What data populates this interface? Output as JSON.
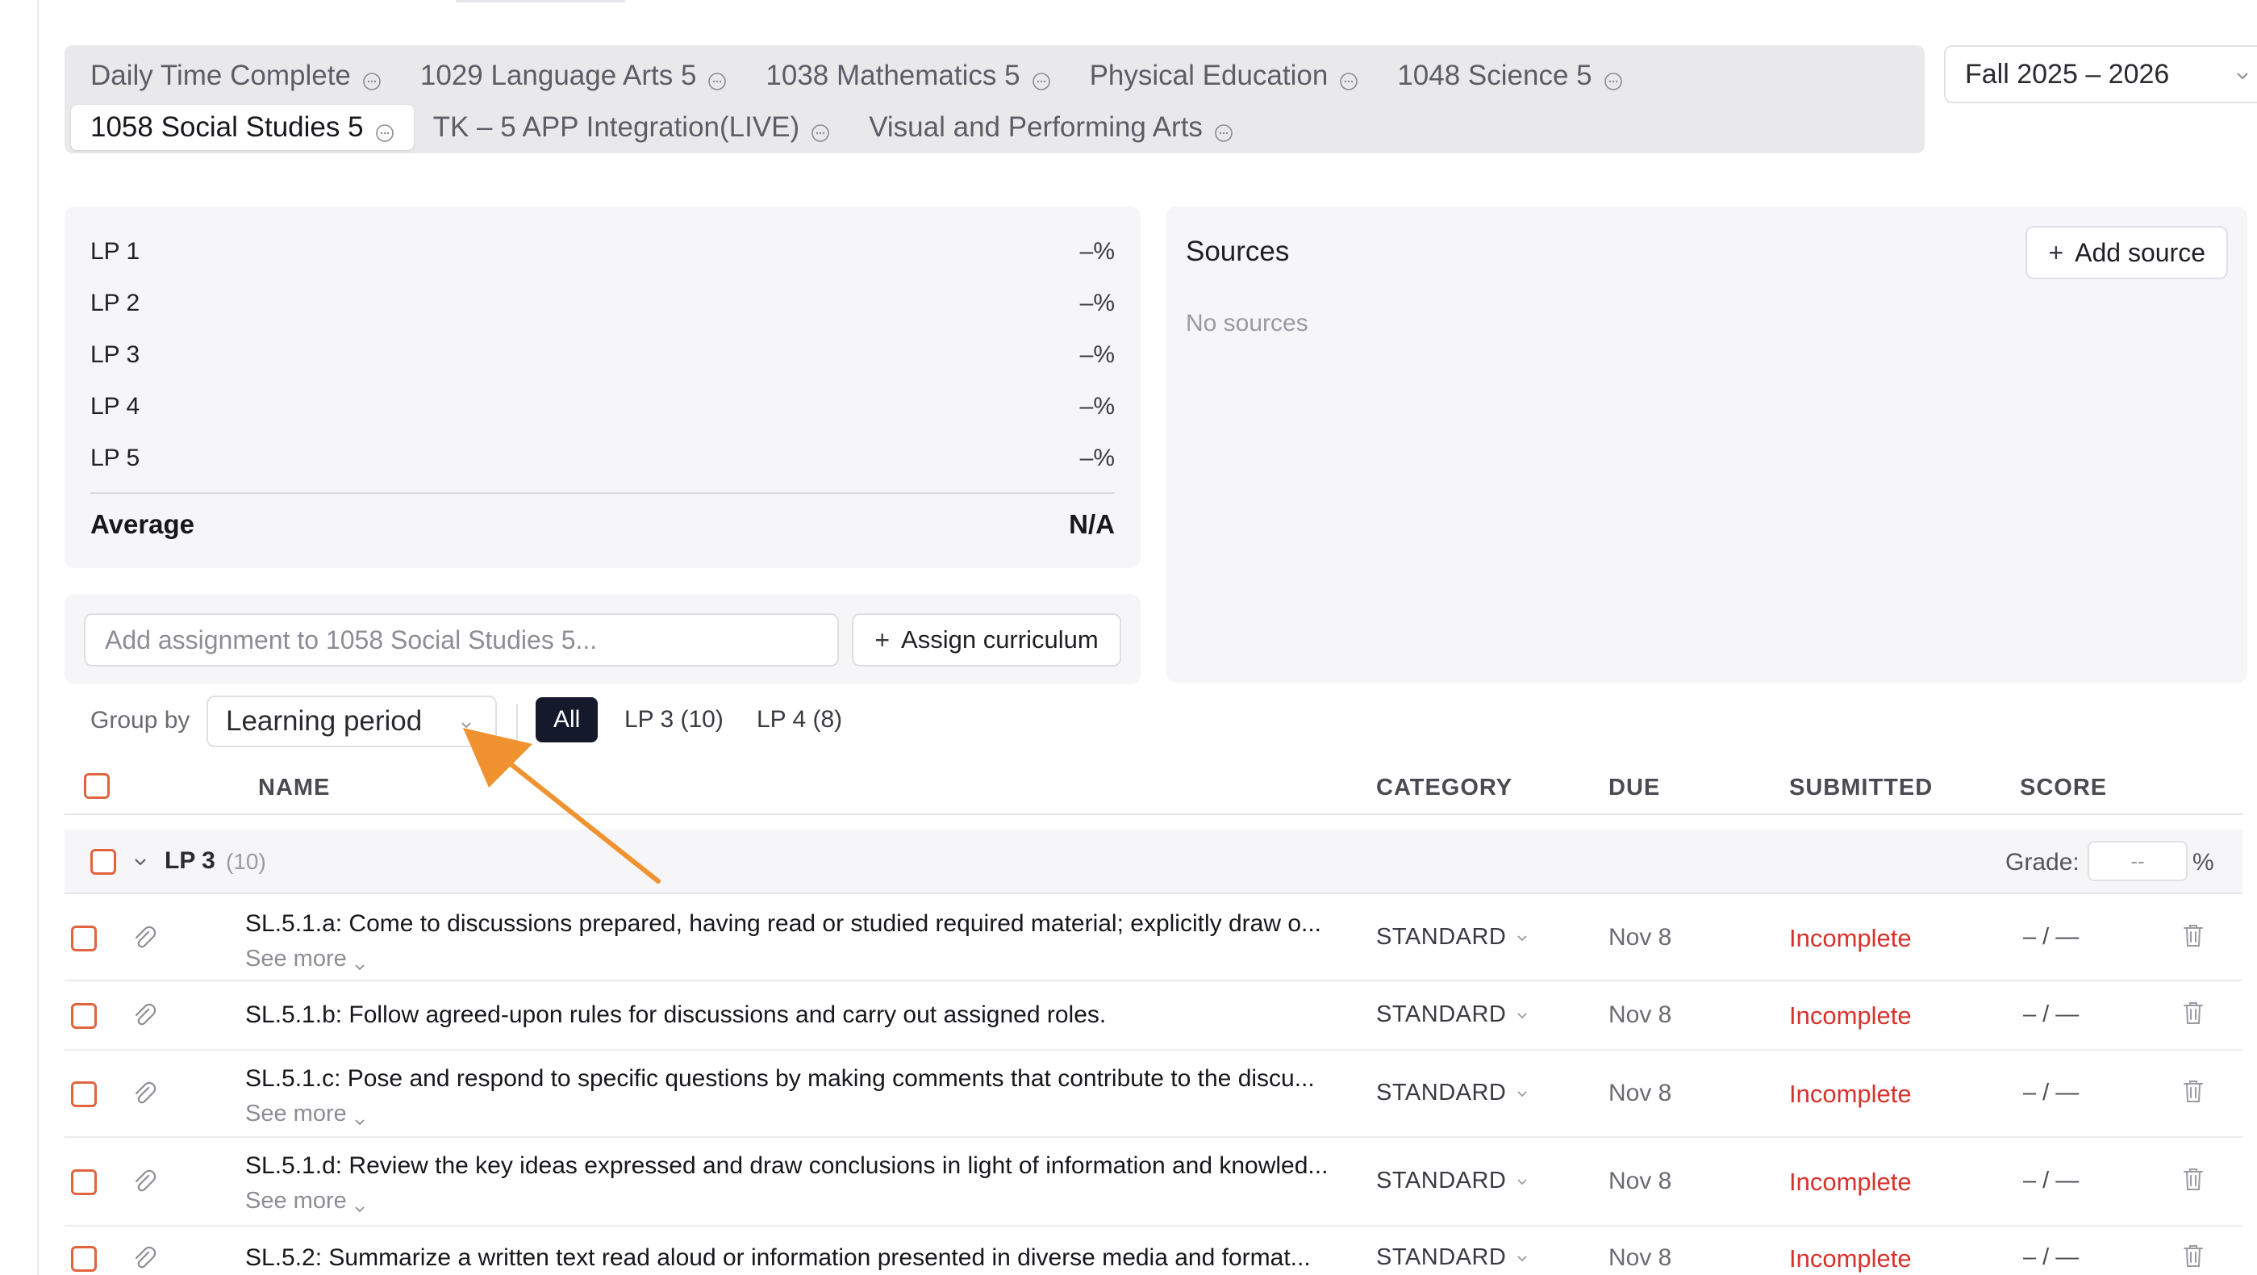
{
  "subjects": {
    "tabs": [
      {
        "label": "Daily Time Complete"
      },
      {
        "label": "1029 Language Arts 5"
      },
      {
        "label": "1038 Mathematics 5"
      },
      {
        "label": "Physical Education"
      },
      {
        "label": "1048 Science 5"
      },
      {
        "label": "1058 Social Studies 5"
      },
      {
        "label": "TK – 5 APP Integration(LIVE)"
      },
      {
        "label": "Visual and Performing Arts"
      }
    ],
    "active": "1058 Social Studies 5",
    "tab_icon": "ellipsis-circle-icon"
  },
  "term": {
    "value": "Fall 2025 – 2026"
  },
  "learning_periods": {
    "rows": [
      {
        "label": "LP 1",
        "value": "–%"
      },
      {
        "label": "LP 2",
        "value": "–%"
      },
      {
        "label": "LP 3",
        "value": "–%"
      },
      {
        "label": "LP 4",
        "value": "–%"
      },
      {
        "label": "LP 5",
        "value": "–%"
      }
    ],
    "average_label": "Average",
    "average_value": "N/A"
  },
  "sources": {
    "title": "Sources",
    "empty_text": "No sources",
    "add_label": "Add source"
  },
  "assignment": {
    "placeholder": "Add assignment to 1058 Social Studies 5...",
    "assign_curriculum_label": "Assign curriculum"
  },
  "groupby": {
    "label": "Group by",
    "value": "Learning period",
    "filters": [
      "All",
      "LP 3 (10)",
      "LP 4 (8)"
    ],
    "active_filter": "All"
  },
  "table": {
    "headers": {
      "name": "NAME",
      "category": "CATEGORY",
      "due": "DUE",
      "submitted": "SUBMITTED",
      "score": "SCORE"
    },
    "group": {
      "title": "LP 3",
      "count": "(10)",
      "grade_label": "Grade:",
      "grade_value": "--",
      "grade_unit": "%"
    },
    "see_more": "See more",
    "rows": [
      {
        "name": "SL.5.1.a: Come to discussions prepared, having read or studied required material; explicitly draw o...",
        "has_see_more": true,
        "category": "STANDARD",
        "due": "Nov 8",
        "submitted": "Incomplete",
        "score": "– / —"
      },
      {
        "name": "SL.5.1.b: Follow agreed-upon rules for discussions and carry out assigned roles.",
        "has_see_more": false,
        "category": "STANDARD",
        "due": "Nov 8",
        "submitted": "Incomplete",
        "score": "– / —"
      },
      {
        "name": "SL.5.1.c: Pose and respond to specific questions by making comments that contribute to the discu...",
        "has_see_more": true,
        "category": "STANDARD",
        "due": "Nov 8",
        "submitted": "Incomplete",
        "score": "– / —"
      },
      {
        "name": "SL.5.1.d: Review the key ideas expressed and draw conclusions in light of information and knowled...",
        "has_see_more": true,
        "category": "STANDARD",
        "due": "Nov 8",
        "submitted": "Incomplete",
        "score": "– / —"
      },
      {
        "name": "SL.5.2: Summarize a written text read aloud or information presented in diverse media and format...",
        "has_see_more": false,
        "category": "STANDARD",
        "due": "Nov 8",
        "submitted": "Incomplete",
        "score": "– / —"
      }
    ]
  },
  "colors": {
    "accent_checkbox": "#e2643f",
    "incomplete": "#d8322c",
    "active_pill": "#141a2b",
    "annotation_arrow": "#f0922f"
  }
}
